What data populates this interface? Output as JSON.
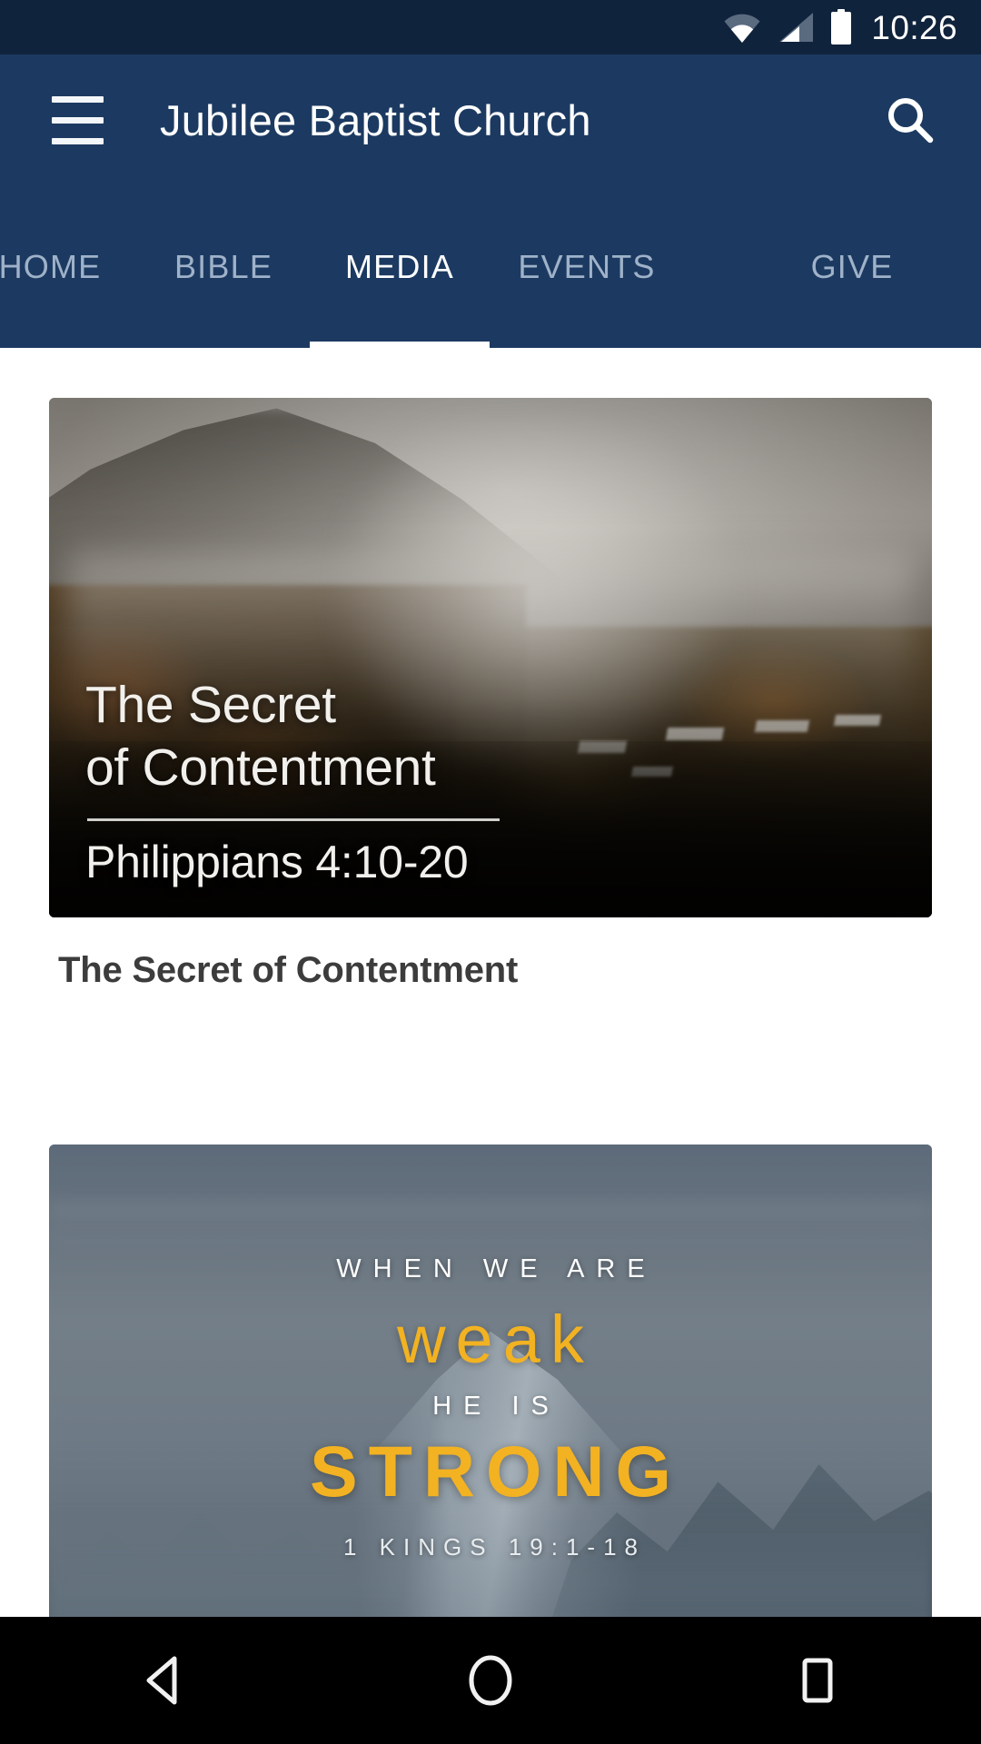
{
  "status_bar": {
    "time": "10:26",
    "icons": [
      "wifi-icon",
      "cellular-signal-icon",
      "battery-icon"
    ]
  },
  "app_bar": {
    "title": "Jubilee Baptist Church",
    "menu_icon": "hamburger-menu-icon",
    "search_icon": "search-icon",
    "background_color": "#1c3a61"
  },
  "tabs": {
    "active_index": 2,
    "items": [
      {
        "label": "HOME"
      },
      {
        "label": "BIBLE"
      },
      {
        "label": "MEDIA"
      },
      {
        "label": "EVENTS"
      },
      {
        "label": "GIVE"
      }
    ]
  },
  "media_list": {
    "items": [
      {
        "caption": "The Secret of Contentment",
        "artwork": {
          "title_line1": "The Secret",
          "title_line2": "of Contentment",
          "scripture_reference": "Philippians 4:10-20"
        }
      },
      {
        "caption": "",
        "artwork": {
          "line1": "WHEN WE ARE",
          "line2": "weak",
          "line3": "HE IS",
          "line4": "STRONG",
          "scripture_reference": "1 KINGS 19:1-18",
          "accent_color": "#f2b222"
        }
      }
    ]
  },
  "nav_bar": {
    "back_icon": "back-triangle-icon",
    "home_icon": "home-circle-icon",
    "recents_icon": "recents-square-icon"
  }
}
